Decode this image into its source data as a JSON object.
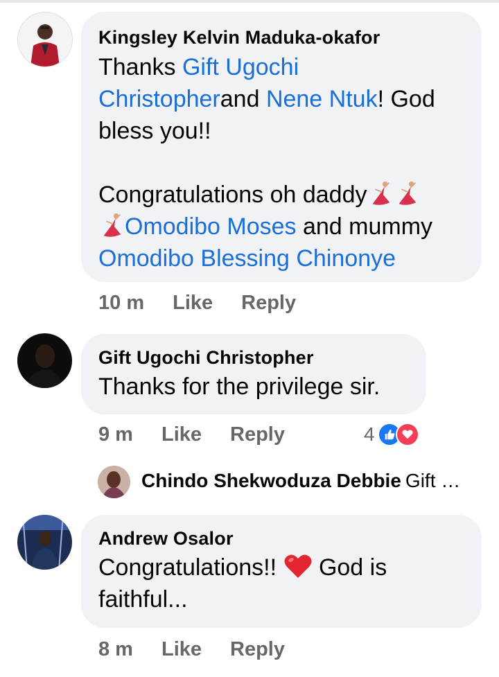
{
  "comments": [
    {
      "author": "Kingsley Kelvin Maduka-okafor",
      "avatar_icon": "profile-photo-man-red-jacket",
      "text_parts": {
        "p1": "Thanks ",
        "m1": "Gift Ugochi",
        "m1b": "Christopher",
        "p2": "and ",
        "m2": "Nene Ntuk",
        "p3": "! God",
        "p4": "bless you!!",
        "p5": "Congratulations oh daddy",
        "m3": "Omodibo Moses",
        "p6": " and mummy",
        "m4": "Omodibo Blessing Chinonye"
      },
      "emoji_icon": "dancing-woman-emoji",
      "time": "10 m",
      "like_label": "Like",
      "reply_label": "Reply"
    },
    {
      "author": "Gift Ugochi Christopher",
      "avatar_icon": "profile-photo-man-dark",
      "text": "Thanks for the privilege sir.",
      "time": "9 m",
      "like_label": "Like",
      "reply_label": "Reply",
      "reactions": {
        "count": "4",
        "icons": [
          "like-icon",
          "love-icon"
        ]
      },
      "reply_preview": {
        "author": "Chindo Shekwoduza Debbie",
        "text": "Gift …",
        "avatar_icon": "profile-photo-woman"
      }
    },
    {
      "author": "Andrew Osalor",
      "avatar_icon": "profile-photo-speaker-stage",
      "text_before": "Congratulations!! ",
      "emoji_icon": "red-heart-emoji",
      "text_after": " God is",
      "text_line2": "faithful...",
      "time": "8 m",
      "like_label": "Like",
      "reply_label": "Reply"
    }
  ],
  "colors": {
    "bubble": "#f0f2f5",
    "mention": "#1a6ed8",
    "meta": "#65676b",
    "like": "#1877f2",
    "love": "#f33e58"
  }
}
